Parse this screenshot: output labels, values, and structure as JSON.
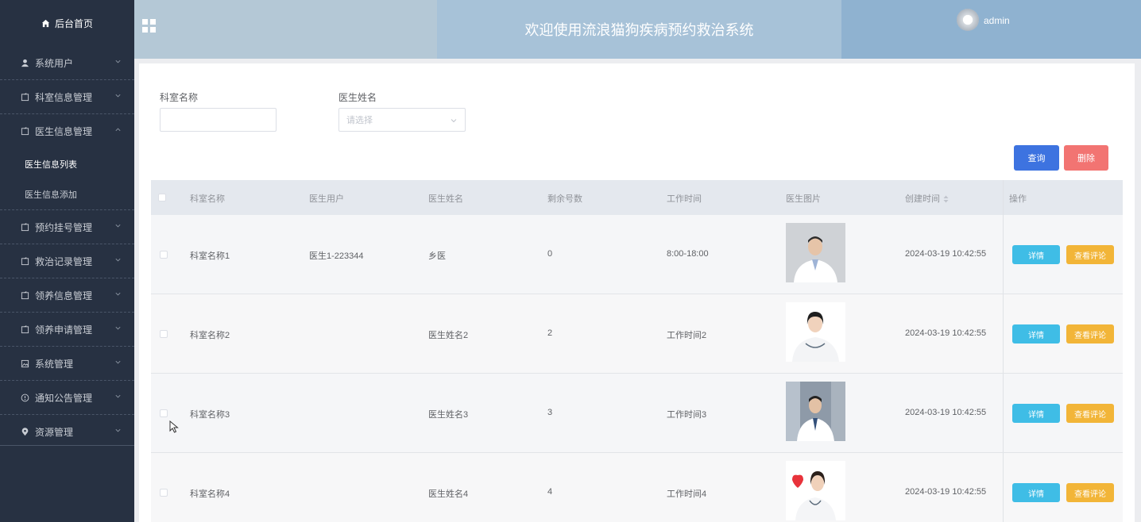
{
  "sidebar": {
    "home": "后台首页",
    "menus": [
      {
        "label": "系统用户",
        "icon": "user-icon"
      },
      {
        "label": "科室信息管理",
        "icon": "folder-icon"
      },
      {
        "label": "医生信息管理",
        "icon": "folder-icon",
        "expanded": true
      },
      {
        "label": "预约挂号管理",
        "icon": "folder-icon"
      },
      {
        "label": "救治记录管理",
        "icon": "folder-icon"
      },
      {
        "label": "领养信息管理",
        "icon": "folder-icon"
      },
      {
        "label": "领养申请管理",
        "icon": "folder-icon"
      },
      {
        "label": "系统管理",
        "icon": "picture-icon"
      },
      {
        "label": "通知公告管理",
        "icon": "info-icon"
      },
      {
        "label": "资源管理",
        "icon": "location-icon"
      }
    ],
    "submenus": [
      "医生信息列表",
      "医生信息添加"
    ]
  },
  "header": {
    "title": "欢迎使用流浪猫狗疾病预约救治系统",
    "username": "admin"
  },
  "filters": {
    "dept_label": "科室名称",
    "dept_value": "",
    "doctor_label": "医生姓名",
    "doctor_placeholder": "请选择"
  },
  "buttons": {
    "search": "查询",
    "delete": "删除"
  },
  "colors": {
    "search": "#3d73e0",
    "delete": "#f27472",
    "detail": "#3fbde6",
    "review": "#f2b538"
  },
  "table": {
    "columns": [
      "科室名称",
      "医生用户",
      "医生姓名",
      "剩余号数",
      "工作时间",
      "医生图片",
      "创建时间",
      "操作"
    ],
    "rows": [
      {
        "dept": "科室名称1",
        "user": "医生1-223344",
        "name": "乡医",
        "remaining": "0",
        "worktime": "8:00-18:00",
        "created": "2024-03-19 10:42:55"
      },
      {
        "dept": "科室名称2",
        "user": "",
        "name": "医生姓名2",
        "remaining": "2",
        "worktime": "工作时间2",
        "created": "2024-03-19 10:42:55"
      },
      {
        "dept": "科室名称3",
        "user": "",
        "name": "医生姓名3",
        "remaining": "3",
        "worktime": "工作时间3",
        "created": "2024-03-19 10:42:55"
      },
      {
        "dept": "科室名称4",
        "user": "",
        "name": "医生姓名4",
        "remaining": "4",
        "worktime": "工作时间4",
        "created": "2024-03-19 10:42:55"
      }
    ],
    "row_actions": {
      "detail": "详情",
      "review": "查看评论"
    }
  }
}
